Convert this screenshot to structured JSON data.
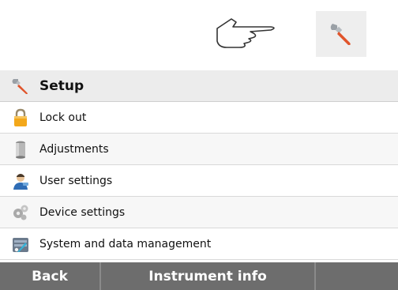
{
  "colors": {
    "accent": "#e0542b",
    "bottom_bar": "#6d6d6d",
    "header_row": "#ececec"
  },
  "top": {
    "hand_icon": "pointing-hand-icon",
    "tool_icon": "wrench-icon"
  },
  "menu": {
    "title": {
      "label": "Setup",
      "icon": "wrench-icon"
    },
    "items": [
      {
        "label": "Lock out",
        "icon": "padlock-icon"
      },
      {
        "label": "Adjustments",
        "icon": "weight-icon"
      },
      {
        "label": "User settings",
        "icon": "user-icon"
      },
      {
        "label": "Device settings",
        "icon": "gears-icon"
      },
      {
        "label": "System and data management",
        "icon": "database-icon"
      }
    ]
  },
  "bottom_bar": {
    "back_label": "Back",
    "info_label": "Instrument info"
  }
}
